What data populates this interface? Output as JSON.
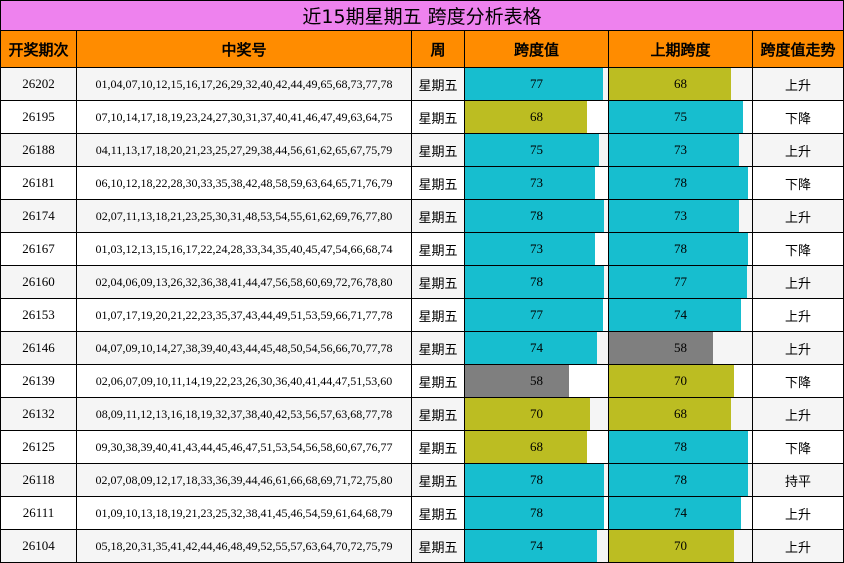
{
  "title": "近15期星期五 跨度分析表格",
  "headers": [
    "开奖期次",
    "中奖号",
    "周",
    "跨度值",
    "上期跨度",
    "跨度值走势"
  ],
  "colors": {
    "title_bg": "#ee82ee",
    "header_bg": "#ff8c00",
    "high": "#17becf",
    "mid": "#bcbd22",
    "low": "#7f7f7f"
  },
  "bar_max": 80,
  "rows": [
    {
      "issue": "26202",
      "numbers": "01,04,07,10,12,15,16,17,26,29,32,40,42,44,49,65,68,73,77,78",
      "week": "星期五",
      "span": 77,
      "prev_span": 68,
      "trend": "上升"
    },
    {
      "issue": "26195",
      "numbers": "07,10,14,17,18,19,23,24,27,30,31,37,40,41,46,47,49,63,64,75",
      "week": "星期五",
      "span": 68,
      "prev_span": 75,
      "trend": "下降"
    },
    {
      "issue": "26188",
      "numbers": "04,11,13,17,18,20,21,23,25,27,29,38,44,56,61,62,65,67,75,79",
      "week": "星期五",
      "span": 75,
      "prev_span": 73,
      "trend": "上升"
    },
    {
      "issue": "26181",
      "numbers": "06,10,12,18,22,28,30,33,35,38,42,48,58,59,63,64,65,71,76,79",
      "week": "星期五",
      "span": 73,
      "prev_span": 78,
      "trend": "下降"
    },
    {
      "issue": "26174",
      "numbers": "02,07,11,13,18,21,23,25,30,31,48,53,54,55,61,62,69,76,77,80",
      "week": "星期五",
      "span": 78,
      "prev_span": 73,
      "trend": "上升"
    },
    {
      "issue": "26167",
      "numbers": "01,03,12,13,15,16,17,22,24,28,33,34,35,40,45,47,54,66,68,74",
      "week": "星期五",
      "span": 73,
      "prev_span": 78,
      "trend": "下降"
    },
    {
      "issue": "26160",
      "numbers": "02,04,06,09,13,26,32,36,38,41,44,47,56,58,60,69,72,76,78,80",
      "week": "星期五",
      "span": 78,
      "prev_span": 77,
      "trend": "上升"
    },
    {
      "issue": "26153",
      "numbers": "01,07,17,19,20,21,22,23,35,37,43,44,49,51,53,59,66,71,77,78",
      "week": "星期五",
      "span": 77,
      "prev_span": 74,
      "trend": "上升"
    },
    {
      "issue": "26146",
      "numbers": "04,07,09,10,14,27,38,39,40,43,44,45,48,50,54,56,66,70,77,78",
      "week": "星期五",
      "span": 74,
      "prev_span": 58,
      "trend": "上升"
    },
    {
      "issue": "26139",
      "numbers": "02,06,07,09,10,11,14,19,22,23,26,30,36,40,41,44,47,51,53,60",
      "week": "星期五",
      "span": 58,
      "prev_span": 70,
      "trend": "下降"
    },
    {
      "issue": "26132",
      "numbers": "08,09,11,12,13,16,18,19,32,37,38,40,42,53,56,57,63,68,77,78",
      "week": "星期五",
      "span": 70,
      "prev_span": 68,
      "trend": "上升"
    },
    {
      "issue": "26125",
      "numbers": "09,30,38,39,40,41,43,44,45,46,47,51,53,54,56,58,60,67,76,77",
      "week": "星期五",
      "span": 68,
      "prev_span": 78,
      "trend": "下降"
    },
    {
      "issue": "26118",
      "numbers": "02,07,08,09,12,17,18,33,36,39,44,46,61,66,68,69,71,72,75,80",
      "week": "星期五",
      "span": 78,
      "prev_span": 78,
      "trend": "持平"
    },
    {
      "issue": "26111",
      "numbers": "01,09,10,13,18,19,21,23,25,32,38,41,45,46,54,59,61,64,68,79",
      "week": "星期五",
      "span": 78,
      "prev_span": 74,
      "trend": "上升"
    },
    {
      "issue": "26104",
      "numbers": "05,18,20,31,35,41,42,44,46,48,49,52,55,57,63,64,70,72,75,79",
      "week": "星期五",
      "span": 74,
      "prev_span": 70,
      "trend": "上升"
    }
  ]
}
